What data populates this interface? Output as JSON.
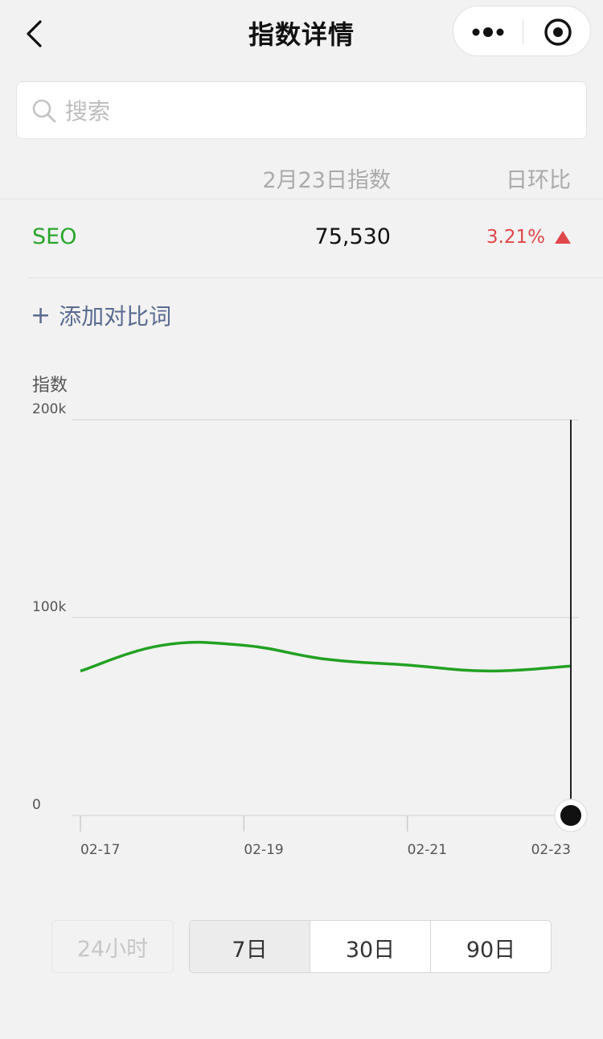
{
  "nav": {
    "title": "指数详情"
  },
  "search": {
    "placeholder": "搜索",
    "value": ""
  },
  "table": {
    "col_index": "2月23日指数",
    "col_change": "日环比",
    "row": {
      "keyword": "SEO",
      "value": "75,530",
      "change": "3.21%",
      "direction": "up"
    }
  },
  "add_compare": {
    "plus": "+",
    "label": "添加对比词"
  },
  "chart_data": {
    "type": "line",
    "ylabel": "指数",
    "ylim": [
      0,
      200000
    ],
    "yticks": [
      {
        "value": 200000,
        "label": "200k"
      },
      {
        "value": 100000,
        "label": "100k"
      },
      {
        "value": 0,
        "label": "0"
      }
    ],
    "x": [
      "02-17",
      "02-18",
      "02-19",
      "02-20",
      "02-21",
      "02-22",
      "02-23"
    ],
    "xtick_labels": [
      "02-17",
      "02-19",
      "02-21",
      "02-23"
    ],
    "series": [
      {
        "values": [
          73000,
          86000,
          86000,
          79000,
          76000,
          73000,
          75530
        ],
        "color": "#22a123"
      }
    ],
    "cursor_index": 6,
    "grid": true
  },
  "ranges": {
    "options": [
      "24小时",
      "7日",
      "30日",
      "90日"
    ],
    "selected": "7日",
    "disabled": "24小时"
  },
  "colors": {
    "green": "#2aa52a",
    "red": "#e0474a",
    "link": "#596b91"
  }
}
